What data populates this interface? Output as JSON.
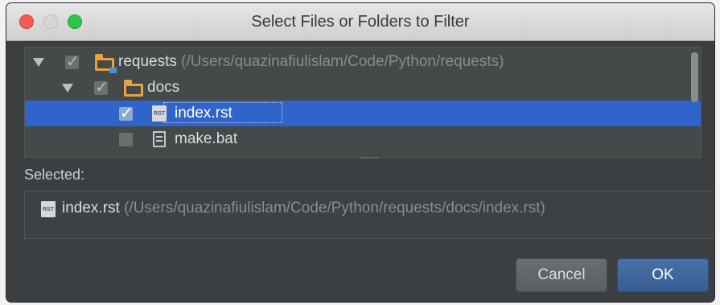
{
  "window": {
    "title": "Select Files or Folders to Filter"
  },
  "tree": {
    "rows": [
      {
        "name": "requests",
        "path": "(/Users/quazinafiulislam/Code/Python/requests)",
        "checked": true
      },
      {
        "name": "docs",
        "checked": true
      },
      {
        "name": "index.rst",
        "checked": true,
        "selected": true
      },
      {
        "name": "make.bat",
        "checked": false
      }
    ]
  },
  "selected": {
    "label": "Selected:",
    "file": "index.rst",
    "path": "(/Users/quazinafiulislam/Code/Python/requests/docs/index.rst)"
  },
  "buttons": {
    "cancel": "Cancel",
    "ok": "OK"
  },
  "icons": {
    "expand": "chevron-down-icon",
    "folder": "folder-icon",
    "rst_file": "rst-file-icon",
    "bat_file": "text-file-icon"
  },
  "colors": {
    "selection": "#2f65ca",
    "folder": "#e7a33e",
    "ok_button": "#3f669c"
  }
}
